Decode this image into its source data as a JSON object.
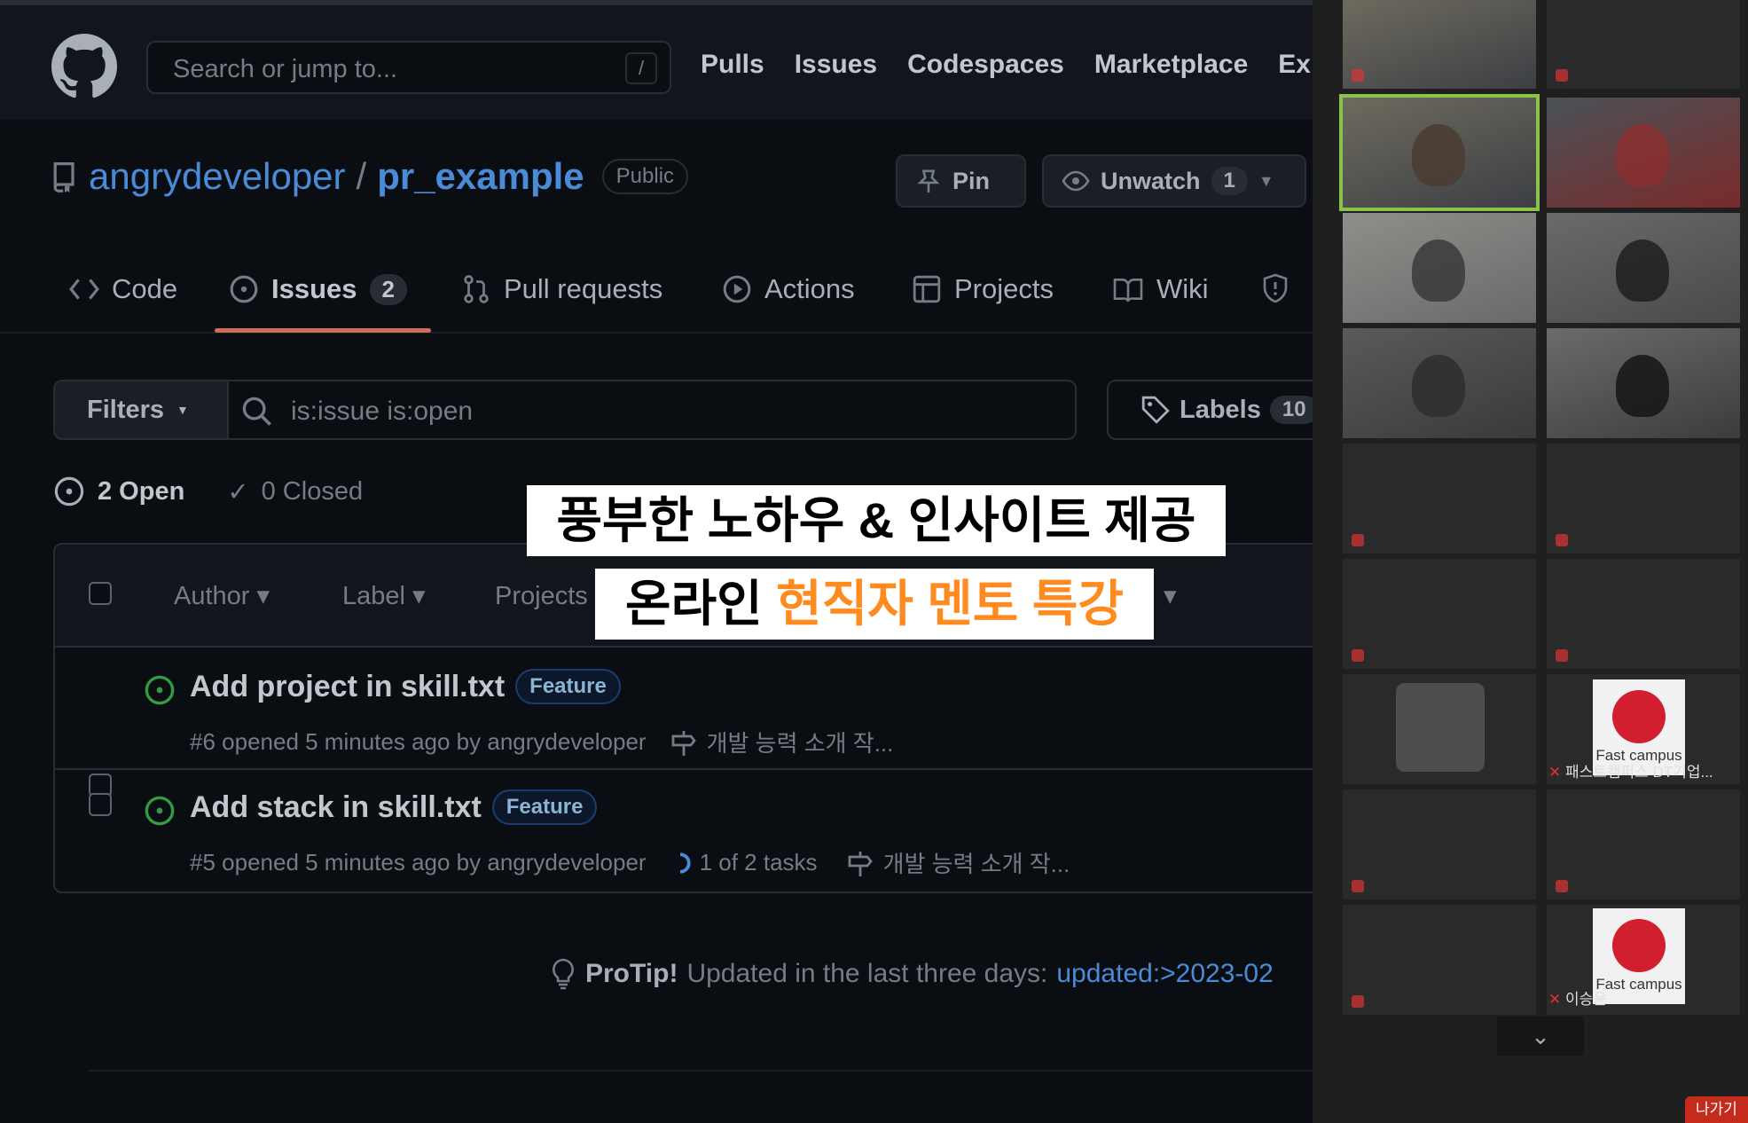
{
  "header": {
    "search_placeholder": "Search or jump to...",
    "search_shortcut": "/",
    "nav": [
      "Pulls",
      "Issues",
      "Codespaces",
      "Marketplace",
      "Ex"
    ]
  },
  "repo": {
    "owner": "angrydeveloper",
    "separator": "/",
    "name": "pr_example",
    "visibility": "Public",
    "pin_label": "Pin",
    "unwatch_label": "Unwatch",
    "watch_count": "1"
  },
  "tabs": {
    "code": "Code",
    "issues": "Issues",
    "issues_count": "2",
    "pulls": "Pull requests",
    "actions": "Actions",
    "projects": "Projects",
    "wiki": "Wiki"
  },
  "filters": {
    "button": "Filters",
    "query": "is:issue is:open",
    "labels_label": "Labels",
    "labels_count": "10"
  },
  "states": {
    "open": "2 Open",
    "closed": "0 Closed"
  },
  "list_header": {
    "author": "Author",
    "label": "Label",
    "projects": "Projects"
  },
  "issues": [
    {
      "title": "Add project in skill.txt",
      "label": "Feature",
      "meta": "#6 opened 5 minutes ago by angrydeveloper",
      "milestone": "개발 능력 소개 작...",
      "tasks": ""
    },
    {
      "title": "Add stack in skill.txt",
      "label": "Feature",
      "meta": "#5 opened 5 minutes ago by angrydeveloper",
      "milestone": "개발 능력 소개 작...",
      "tasks": "1 of 2 tasks"
    }
  ],
  "protip": {
    "bold": "ProTip!",
    "text": "Updated in the last three days:",
    "query": "updated:>2023-02"
  },
  "captions": {
    "line1": "풍부한 노하우 & 인사이트 제공",
    "line2_plain": "온라인 ",
    "line2_accent": "현직자 멘토 특강"
  },
  "zoom": {
    "fc_logo_text": "Fast campus",
    "participant_fc1": "패스트캠퍼스 DT기업...",
    "participant_fc2": "이승윤",
    "scroll_glyph": "⌄",
    "leave_label": "나가기"
  },
  "colors": {
    "accent_orange": "#ff8a1f",
    "github_link": "#58a6ff",
    "open_green": "#3fb950",
    "tab_underline": "#f78166"
  }
}
